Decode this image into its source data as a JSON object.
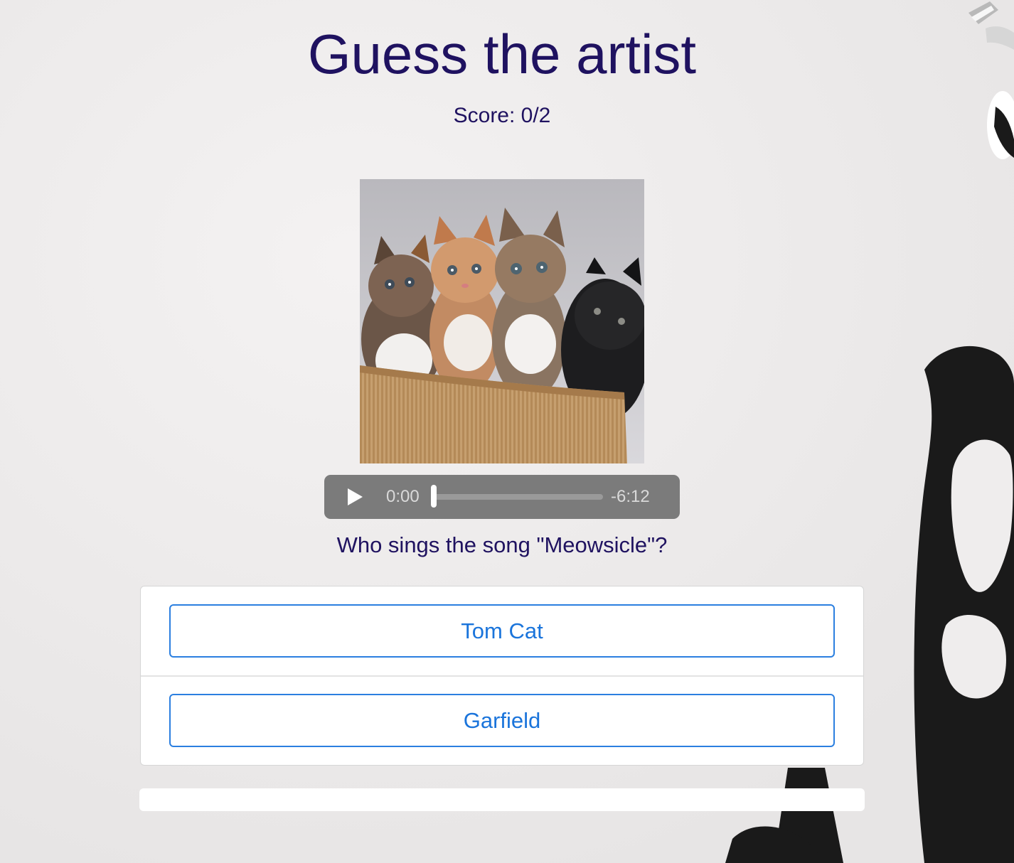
{
  "header": {
    "title": "Guess the artist",
    "score": "Score: 0/2"
  },
  "cover": {
    "subject": "four kittens sitting in a woven basket"
  },
  "player": {
    "current_time": "0:00",
    "remaining_time": "-6:12",
    "progress": 0,
    "play_icon": "play-icon"
  },
  "quiz": {
    "question": "Who sings the song \"Meowsicle\"?",
    "answers": [
      {
        "label": "Tom Cat"
      },
      {
        "label": "Garfield"
      }
    ]
  },
  "colors": {
    "heading": "#1f1260",
    "answer_accent": "#2b7fe0",
    "background": "#eeecec",
    "player_bg": "#7b7b7b"
  },
  "result": {
    "progress": 0
  }
}
